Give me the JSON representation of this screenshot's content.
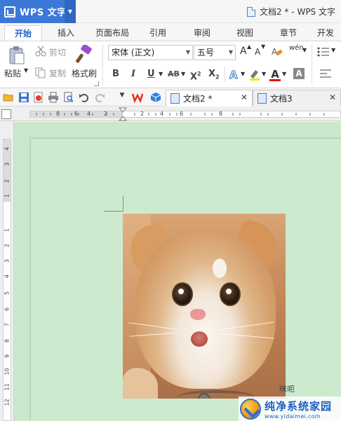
{
  "app": {
    "name": "WPS 文字",
    "window_title": "文档2 * - WPS 文字"
  },
  "menu_tabs": [
    "开始",
    "插入",
    "页面布局",
    "引用",
    "审阅",
    "视图",
    "章节",
    "开发工"
  ],
  "ribbon": {
    "clipboard": {
      "paste": "粘贴",
      "cut": "剪切",
      "copy": "复制",
      "format_painter": "格式刷"
    },
    "font": {
      "family": "宋体 (正文)",
      "size": "五号",
      "grow": "A",
      "shrink": "A",
      "bold": "B",
      "italic": "I",
      "underline": "U",
      "strikethrough": "AB",
      "superscript": "X",
      "superscript_exp": "2",
      "subscript": "X",
      "subscript_exp": "2",
      "font_color": "A",
      "phonetic": "wén"
    }
  },
  "doc_tabs": [
    {
      "label": "文档2 *",
      "active": true
    },
    {
      "label": "文档3",
      "active": false
    }
  ],
  "ruler": {
    "top_numbers": [
      "8",
      "6",
      "4",
      "2",
      "2",
      "4",
      "6",
      "8"
    ],
    "left_numbers": [
      "4",
      "3",
      "2",
      "1",
      "1",
      "2",
      "3",
      "4",
      "5",
      "6",
      "7",
      "8",
      "9",
      "10",
      "11",
      "12"
    ]
  },
  "document": {
    "image_watermark": "咪呃"
  },
  "site_logo": {
    "name": "纯净系统家园",
    "url": "www.yidaimei.com"
  },
  "colors": {
    "accent": "#3c78d8",
    "doc_background": "#cbe7cc",
    "active_tab_text": "#2a62c4"
  }
}
